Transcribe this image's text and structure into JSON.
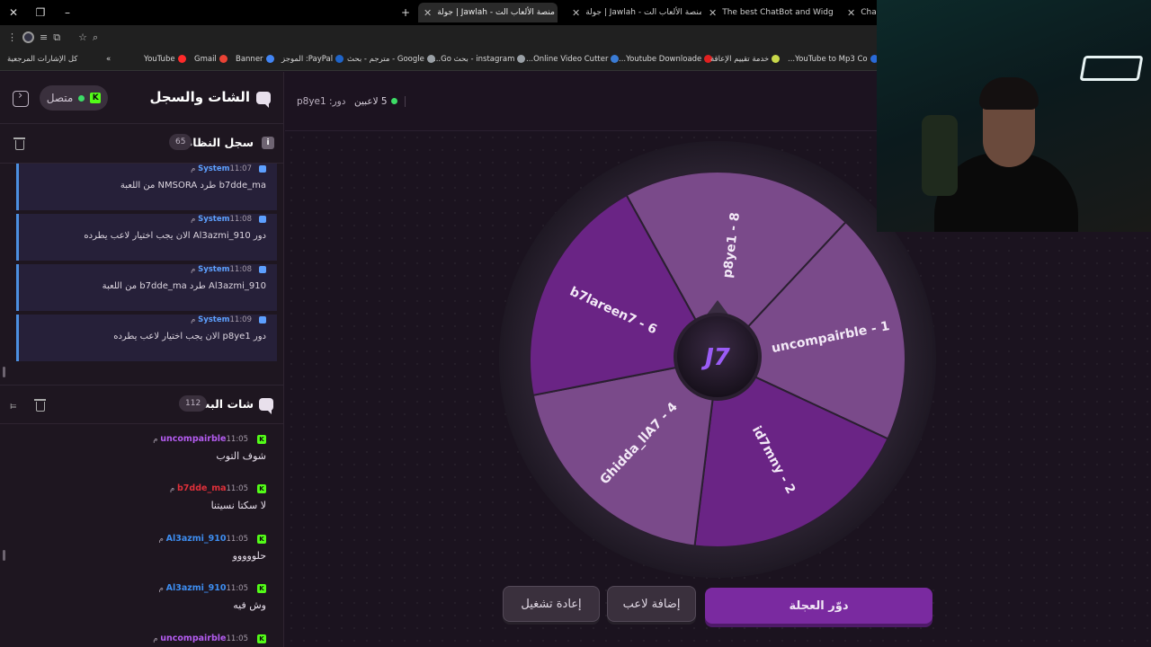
{
  "browser": {
    "tabs": [
      {
        "title": "جولة | Jawlah - منصة الألعاب الت",
        "active": true
      },
      {
        "title": "جولة | Jawlah - منصة الألعاب الت",
        "active": false
      },
      {
        "title": "The best ChatBot and Widg",
        "active": false
      },
      {
        "title": "Cha",
        "active": false
      }
    ],
    "bookmarks": [
      {
        "label": "كل الإشارات المرجعية",
        "color": "#8a8a8a"
      },
      {
        "label": "YouTube",
        "color": "#ff2a2a"
      },
      {
        "label": "Gmail",
        "color": "#ea4335"
      },
      {
        "label": "Banner",
        "color": "#4285f4"
      },
      {
        "label": "PayPal: الموجز",
        "color": "#1f64c8"
      },
      {
        "label": "Google - مترجم - بحث",
        "color": "#9aa0a6"
      },
      {
        "label": "instagram - بحث Go...",
        "color": "#9aa0a6"
      },
      {
        "label": "Online Video Cutter...",
        "color": "#3a7bd5"
      },
      {
        "label": "Youtube Downloade...",
        "color": "#e02020"
      },
      {
        "label": "خدمة تقييم الإعاقة",
        "color": "#c8d84a"
      },
      {
        "label": "YouTube to Mp3 Co...",
        "color": "#2a6ad8"
      }
    ]
  },
  "sidebar": {
    "title": "الشات والسجل",
    "status": "متصل",
    "system_log": {
      "title": "سجل النظام",
      "count": "65",
      "entries": [
        {
          "user": "System",
          "time": "11:07 م",
          "text": "b7dde_ma طرد NMSORA من اللعبة"
        },
        {
          "user": "System",
          "time": "11:08 م",
          "text": "دور Al3azmi_910 الان يجب اختيار لاعب يطرده"
        },
        {
          "user": "System",
          "time": "11:08 م",
          "text": "Al3azmi_910 طرد b7dde_ma من اللعبة"
        },
        {
          "user": "System",
          "time": "11:09 م",
          "text": "دور p8ye1 الان يجب اختيار لاعب يطرده"
        }
      ]
    },
    "stream_chat": {
      "title": "شات البث",
      "count": "112",
      "messages": [
        {
          "user": "uncompairble",
          "time": "11:05 م",
          "text": "شوف التوب",
          "color": "#b45cf0"
        },
        {
          "user": "b7dde_ma",
          "time": "11:05 م",
          "text": "لا سكتا نسيتنا",
          "color": "#e0303a"
        },
        {
          "user": "Al3azmi_910",
          "time": "11:05 م",
          "text": "حلووووو",
          "color": "#3d8df0"
        },
        {
          "user": "Al3azmi_910",
          "time": "11:05 م",
          "text": "وش فيه",
          "color": "#3d8df0"
        },
        {
          "user": "uncompairble",
          "time": "11:05 م",
          "text": "",
          "color": "#b45cf0"
        }
      ]
    }
  },
  "game": {
    "players_label": "5 لاعبين",
    "turn_label": "دور: p8ye1",
    "wheel_segments": [
      {
        "label": "p8ye1 - 8",
        "color": "#7a4a8a"
      },
      {
        "label": "uncompairble - 1",
        "color": "#7a4a8a"
      },
      {
        "label": "id7mny - 2",
        "color": "#6a2485"
      },
      {
        "label": "Ghidda_llA7 - 4",
        "color": "#7a4a8a"
      },
      {
        "label": "b7lareen7 - 6",
        "color": "#6a2485"
      }
    ],
    "buttons": {
      "spin": "دوّر العجلة",
      "add_player": "إضافة لاعب",
      "restart": "إعادة تشغيل"
    }
  }
}
